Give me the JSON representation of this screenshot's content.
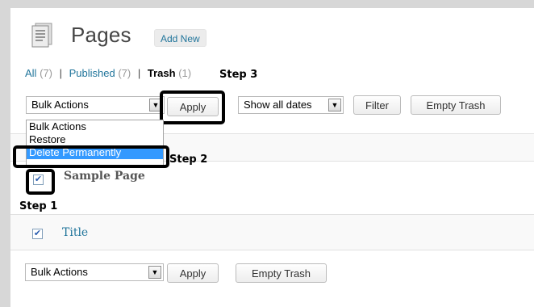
{
  "header": {
    "title": "Pages",
    "add_new": "Add New"
  },
  "filters": {
    "all_label": "All",
    "all_count": "(7)",
    "published_label": "Published",
    "published_count": "(7)",
    "trash_label": "Trash",
    "trash_count": "(1)",
    "separator": "|"
  },
  "annotations": {
    "step1": "Step 1",
    "step2": "Step 2",
    "step3": "Step 3"
  },
  "top_toolbar": {
    "bulk_actions_value": "Bulk Actions",
    "apply_label": "Apply",
    "dates_value": "Show all dates",
    "filter_label": "Filter",
    "empty_trash_label": "Empty Trash"
  },
  "bulk_dropdown": {
    "options": [
      "Bulk Actions",
      "Restore",
      "Delete Permanently"
    ],
    "selected_index": 2
  },
  "table": {
    "rows": [
      {
        "title": "Sample Page",
        "checked": true
      }
    ],
    "footer_column_title": "Title"
  },
  "bottom_toolbar": {
    "bulk_actions_value": "Bulk Actions",
    "apply_label": "Apply",
    "empty_trash_label": "Empty Trash"
  },
  "icons": {
    "pages": "pages-icon",
    "dropdown_arrow": "chevron-down-icon",
    "checkmark": "checkmark-icon"
  }
}
